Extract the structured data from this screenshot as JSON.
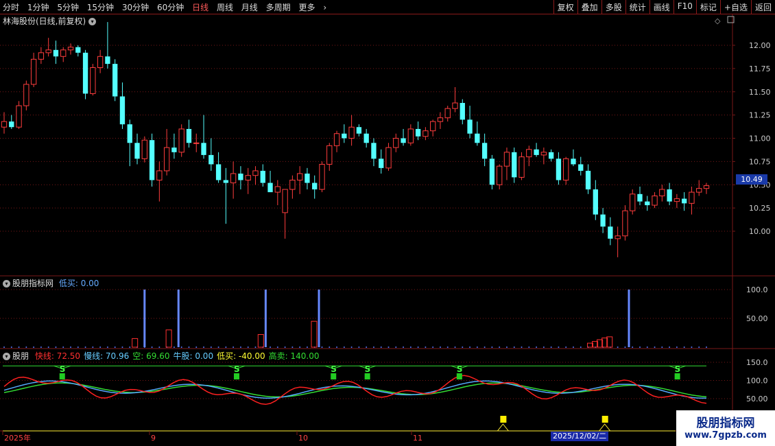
{
  "toolbar": {
    "periods": [
      "分时",
      "1分钟",
      "5分钟",
      "15分钟",
      "30分钟",
      "60分钟",
      "日线",
      "周线",
      "月线",
      "多周期",
      "更多"
    ],
    "active_period": "日线",
    "actions": [
      "复权",
      "叠加",
      "多股",
      "统计",
      "画线",
      "F10",
      "标记",
      "+自选",
      "返回"
    ]
  },
  "stock_title": "林海股份(日线,前复权)",
  "price_axis": {
    "ticks": [
      "12.00",
      "11.75",
      "11.50",
      "11.25",
      "11.00",
      "10.75",
      "10.50",
      "10.25",
      "10.00"
    ],
    "last_price": "10.49"
  },
  "indicator1": {
    "name": "股朋指标网",
    "legend": "低买: 0.00",
    "ticks": [
      "100.0",
      "50.00"
    ]
  },
  "indicator2": {
    "name": "股朋",
    "legend": [
      {
        "label": "快线: 72.50",
        "color": "#ff3030"
      },
      {
        "label": "慢线: 70.96",
        "color": "#66ccff"
      },
      {
        "label": "空: 69.60",
        "color": "#33dd33"
      },
      {
        "label": "牛股: 0.00",
        "color": "#66ccff"
      },
      {
        "label": "低买: -40.00",
        "color": "#ffff33"
      },
      {
        "label": "高卖: 140.00",
        "color": "#33dd33"
      }
    ],
    "ticks": [
      "150.0",
      "100.0",
      "50.00"
    ],
    "signal_letter": "S"
  },
  "date_axis": {
    "labels": [
      "2025年",
      "9",
      "10",
      "11"
    ],
    "cursor_date": "2025/12/02/二"
  },
  "watermark": {
    "line1": "股朋指标网",
    "line2": "www.7gpzb.com"
  },
  "colors": {
    "up": "#ff3d3d",
    "down": "#54ffff",
    "grid": "#7a1818",
    "fast": "#ff2020",
    "slow": "#55aaff",
    "empty": "#33dd33"
  },
  "chart_data": {
    "type": "candlestick",
    "candles": [
      [
        11.12,
        11.28,
        11.05,
        11.18
      ],
      [
        11.18,
        11.25,
        11.1,
        11.12
      ],
      [
        11.12,
        11.4,
        11.1,
        11.35
      ],
      [
        11.35,
        11.62,
        11.3,
        11.58
      ],
      [
        11.58,
        11.92,
        11.55,
        11.85
      ],
      [
        11.85,
        11.98,
        11.8,
        11.92
      ],
      [
        11.92,
        12.08,
        11.88,
        11.95
      ],
      [
        11.95,
        12.05,
        11.8,
        11.88
      ],
      [
        11.88,
        11.98,
        11.82,
        11.95
      ],
      [
        11.95,
        12.02,
        11.9,
        11.98
      ],
      [
        11.98,
        12.0,
        11.88,
        11.92
      ],
      [
        11.92,
        11.95,
        11.42,
        11.48
      ],
      [
        11.48,
        11.8,
        11.46,
        11.76
      ],
      [
        11.76,
        11.95,
        11.7,
        11.88
      ],
      [
        11.88,
        12.25,
        11.75,
        11.8
      ],
      [
        11.8,
        11.85,
        11.4,
        11.45
      ],
      [
        11.45,
        11.6,
        11.1,
        11.15
      ],
      [
        11.15,
        11.2,
        10.7,
        10.95
      ],
      [
        10.95,
        11.05,
        10.72,
        10.78
      ],
      [
        10.78,
        11.02,
        10.74,
        10.98
      ],
      [
        10.98,
        11.05,
        10.48,
        10.55
      ],
      [
        10.55,
        10.75,
        10.32,
        10.65
      ],
      [
        10.65,
        11.1,
        10.6,
        10.9
      ],
      [
        10.9,
        11.05,
        10.78,
        10.85
      ],
      [
        10.85,
        11.15,
        10.8,
        11.1
      ],
      [
        11.1,
        11.2,
        10.9,
        10.95
      ],
      [
        10.95,
        11.05,
        10.85,
        10.95
      ],
      [
        10.95,
        11.25,
        10.78,
        10.82
      ],
      [
        10.82,
        11.0,
        10.65,
        10.72
      ],
      [
        10.72,
        10.85,
        10.52,
        10.55
      ],
      [
        10.55,
        10.68,
        10.08,
        10.52
      ],
      [
        10.52,
        10.75,
        10.35,
        10.62
      ],
      [
        10.62,
        10.7,
        10.45,
        10.55
      ],
      [
        10.55,
        10.68,
        10.4,
        10.6
      ],
      [
        10.6,
        10.7,
        10.5,
        10.65
      ],
      [
        10.65,
        10.72,
        10.48,
        10.52
      ],
      [
        10.52,
        10.65,
        10.45,
        10.42
      ],
      [
        10.42,
        10.55,
        10.28,
        10.48
      ],
      [
        10.2,
        10.4,
        9.92,
        10.45
      ],
      [
        10.45,
        10.6,
        10.35,
        10.55
      ],
      [
        10.55,
        10.7,
        10.4,
        10.62
      ],
      [
        10.62,
        10.68,
        10.45,
        10.52
      ],
      [
        10.52,
        10.6,
        10.35,
        10.45
      ],
      [
        10.45,
        10.75,
        10.42,
        10.72
      ],
      [
        10.72,
        10.95,
        10.65,
        10.92
      ],
      [
        10.92,
        11.08,
        10.85,
        11.05
      ],
      [
        11.05,
        11.15,
        10.95,
        11.0
      ],
      [
        11.0,
        11.25,
        10.92,
        11.12
      ],
      [
        11.12,
        11.15,
        11.02,
        11.05
      ],
      [
        11.05,
        11.1,
        10.9,
        10.95
      ],
      [
        10.95,
        11.0,
        10.7,
        10.78
      ],
      [
        10.78,
        10.88,
        10.62,
        10.68
      ],
      [
        10.68,
        10.95,
        10.65,
        10.9
      ],
      [
        10.9,
        11.05,
        10.85,
        11.0
      ],
      [
        11.0,
        11.1,
        10.92,
        10.95
      ],
      [
        10.95,
        11.15,
        10.92,
        11.1
      ],
      [
        11.1,
        11.18,
        10.98,
        11.02
      ],
      [
        11.02,
        11.12,
        10.98,
        11.08
      ],
      [
        11.08,
        11.2,
        11.02,
        11.18
      ],
      [
        11.18,
        11.28,
        11.1,
        11.22
      ],
      [
        11.22,
        11.35,
        11.18,
        11.32
      ],
      [
        11.32,
        11.55,
        11.28,
        11.38
      ],
      [
        11.38,
        11.42,
        11.15,
        11.2
      ],
      [
        11.2,
        11.35,
        11.0,
        11.05
      ],
      [
        11.05,
        11.18,
        10.92,
        10.95
      ],
      [
        10.95,
        11.05,
        10.7,
        10.78
      ],
      [
        10.78,
        10.82,
        10.45,
        10.5
      ],
      [
        10.5,
        10.72,
        10.45,
        10.7
      ],
      [
        10.7,
        10.9,
        10.55,
        10.85
      ],
      [
        10.85,
        10.9,
        10.52,
        10.58
      ],
      [
        10.58,
        10.85,
        10.55,
        10.8
      ],
      [
        10.8,
        10.92,
        10.7,
        10.88
      ],
      [
        10.88,
        10.95,
        10.8,
        10.82
      ],
      [
        10.82,
        10.9,
        10.72,
        10.85
      ],
      [
        10.85,
        10.88,
        10.75,
        10.78
      ],
      [
        10.78,
        10.85,
        10.5,
        10.55
      ],
      [
        10.55,
        10.8,
        10.5,
        10.78
      ],
      [
        10.78,
        10.88,
        10.7,
        10.72
      ],
      [
        10.72,
        10.8,
        10.6,
        10.65
      ],
      [
        10.65,
        10.72,
        10.4,
        10.45
      ],
      [
        10.45,
        10.55,
        10.12,
        10.18
      ],
      [
        10.18,
        10.25,
        9.98,
        10.05
      ],
      [
        10.05,
        10.15,
        9.85,
        9.92
      ],
      [
        9.92,
        10.05,
        9.72,
        9.95
      ],
      [
        9.95,
        10.28,
        9.9,
        10.22
      ],
      [
        10.22,
        10.45,
        10.18,
        10.4
      ],
      [
        10.4,
        10.48,
        10.28,
        10.32
      ],
      [
        10.32,
        10.38,
        10.22,
        10.28
      ],
      [
        10.28,
        10.42,
        10.25,
        10.38
      ],
      [
        10.38,
        10.5,
        10.32,
        10.45
      ],
      [
        10.45,
        10.52,
        10.28,
        10.32
      ],
      [
        10.32,
        10.4,
        10.25,
        10.35
      ],
      [
        10.35,
        10.42,
        10.22,
        10.3
      ],
      [
        10.3,
        10.48,
        10.18,
        10.42
      ],
      [
        10.42,
        10.55,
        10.38,
        10.46
      ],
      [
        10.46,
        10.52,
        10.4,
        10.49
      ]
    ],
    "indicator1_red_bars": [
      {
        "i": 27,
        "v": 15
      },
      {
        "i": 34,
        "v": 30
      },
      {
        "i": 53,
        "v": 22
      },
      {
        "i": 64,
        "v": 45
      },
      {
        "i": 121,
        "v": 7
      },
      {
        "i": 122,
        "v": 10
      },
      {
        "i": 123,
        "v": 13
      },
      {
        "i": 124,
        "v": 16
      },
      {
        "i": 125,
        "v": 18
      }
    ],
    "indicator1_blue_bars": [
      29,
      36,
      54,
      65,
      129
    ],
    "indicator2_s_signals": [
      12,
      48,
      68,
      75,
      94,
      139
    ],
    "indicator2_yellow_signals": [
      103,
      124
    ]
  }
}
